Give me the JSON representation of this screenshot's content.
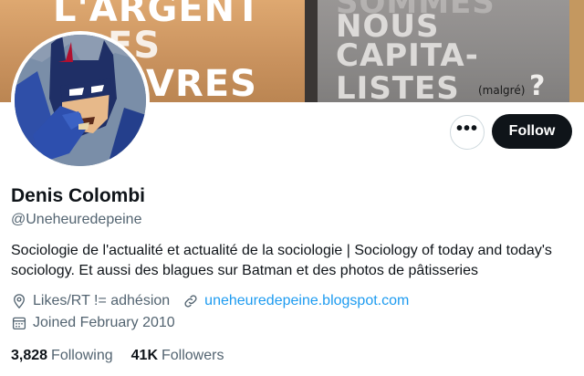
{
  "banner": {
    "left_lines": [
      "L'ARGENT",
      "ES",
      "VRES"
    ],
    "right_lines": [
      "NOUS",
      "CAPITA-",
      "LISTES"
    ],
    "right_faint": "SOMMES",
    "question_mark": "?",
    "handwritten": "(malgré)"
  },
  "actions": {
    "more_label": "•••",
    "follow_label": "Follow"
  },
  "profile": {
    "name": "Denis Colombi",
    "handle": "@Uneheuredepeine",
    "bio": "Sociologie de l'actualité et actualité de la sociologie | Sociology of today and today's sociology. Et aussi des blagues sur Batman et des photos de pâtisseries",
    "location": "Likes/RT != adhésion",
    "website": "uneheuredepeine.blogspot.com",
    "joined": "Joined February 2010"
  },
  "stats": {
    "following_count": "3,828",
    "following_label": "Following",
    "followers_count": "41K",
    "followers_label": "Followers"
  },
  "colors": {
    "accent": "#1d9bf0",
    "text_primary": "#0f1419",
    "text_secondary": "#536471",
    "button_dark": "#0f1419"
  },
  "icons": [
    "location-icon",
    "link-icon",
    "calendar-icon",
    "more-icon"
  ]
}
